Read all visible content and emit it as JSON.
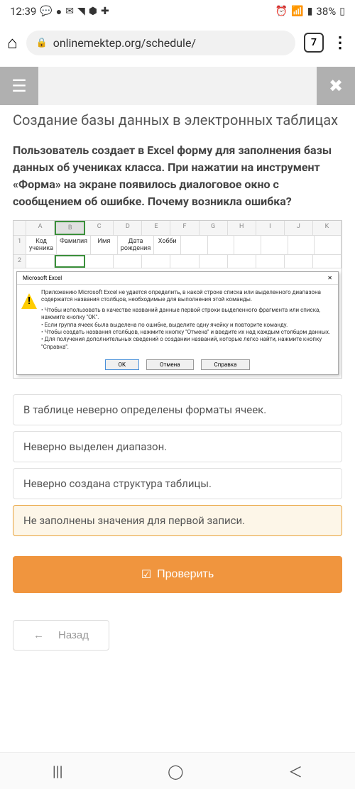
{
  "status": {
    "time": "12:39",
    "battery": "38%"
  },
  "browser": {
    "url": "onlinemektep.org/schedule/",
    "tab_count": "7"
  },
  "page": {
    "title": "Создание базы данных в электронных таблицах",
    "question": "Пользователь создает в Excel форму для заполнения базы данных об учениках класса. При нажатии на инструмент «Форма» на экране появилось диалоговое окно с сообщением об ошибке. Почему возникла ошибка?"
  },
  "excel": {
    "cols": [
      "A",
      "B",
      "C",
      "D",
      "E",
      "F",
      "G",
      "H",
      "I",
      "J",
      "K"
    ],
    "headers": [
      "Код ученика",
      "Фамилия",
      "Имя",
      "Дата рождения",
      "Хобби"
    ],
    "dialog_title": "Microsoft Excel",
    "dialog_text": "Приложению Microsoft Excel не удается определить, в какой строке списка или выделенного диапазона содержатся названия столбцов, необходимые для выполнения этой команды.",
    "dialog_bullets": "• Чтобы использовать в качестве названий данные первой строки выделенного фрагмента или списка, нажмите кнопку \"OK\".\n• Если группа ячеек была выделена по ошибке, выделите одну ячейку и повторите команду.\n• Чтобы создать названия столбцов, нажмите кнопку \"Отмена\" и введите их над каждым столбцом данных.\n• Для получения дополнительных сведений о создании названий, которые легко найти, нажмите кнопку \"Справка\".",
    "btn_ok": "OK",
    "btn_cancel": "Отмена",
    "btn_help": "Справка"
  },
  "options": [
    {
      "label": "В таблице неверно определены форматы ячеек.",
      "selected": false
    },
    {
      "label": "Неверно выделен диапазон.",
      "selected": false
    },
    {
      "label": "Неверно создана структура таблицы.",
      "selected": false
    },
    {
      "label": "Не заполнены значения для первой записи.",
      "selected": true
    }
  ],
  "buttons": {
    "check": "Проверить",
    "back": "Назад"
  }
}
